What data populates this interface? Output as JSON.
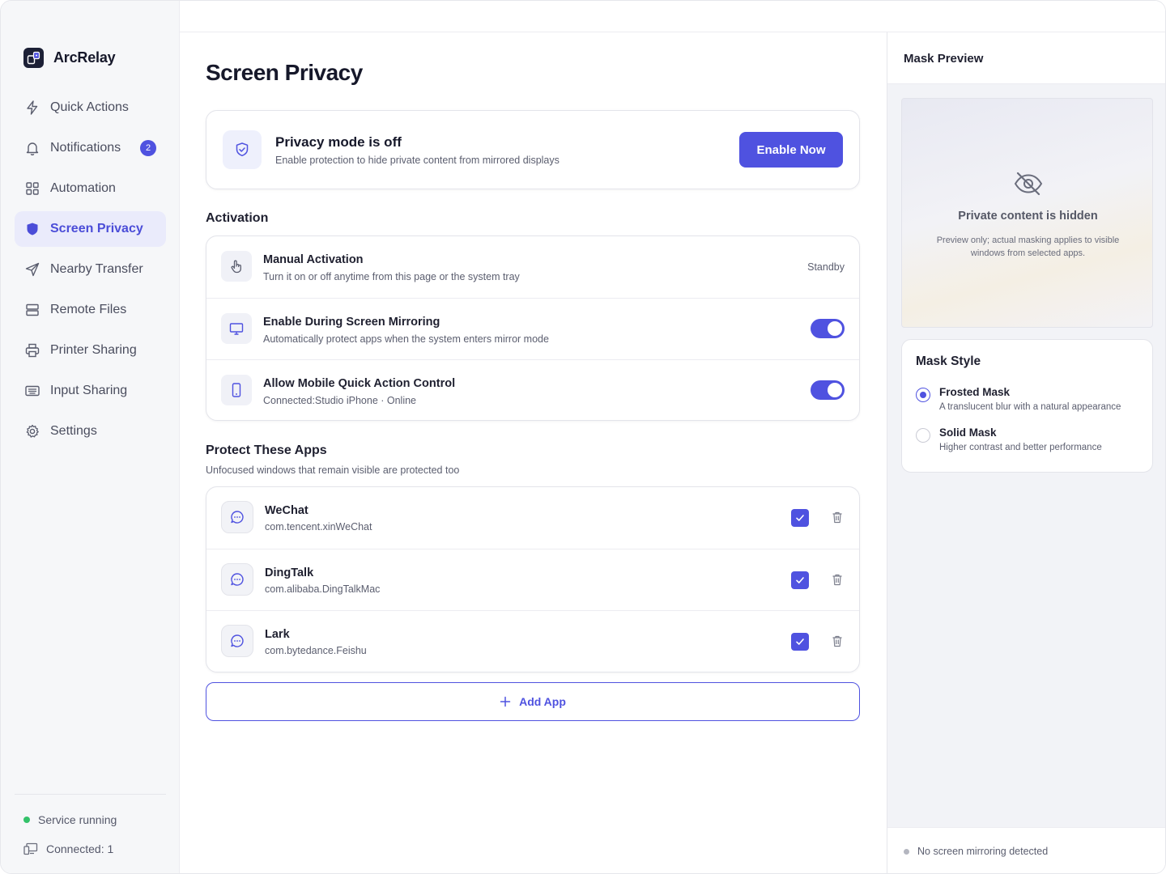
{
  "app": {
    "name": "ArcRelay"
  },
  "sidebar": {
    "items": [
      {
        "label": "Quick Actions",
        "icon": "lightning-icon"
      },
      {
        "label": "Notifications",
        "icon": "bell-icon",
        "badge": "2"
      },
      {
        "label": "Automation",
        "icon": "grid-icon"
      },
      {
        "label": "Screen Privacy",
        "icon": "shield-icon",
        "active": true
      },
      {
        "label": "Nearby Transfer",
        "icon": "send-icon"
      },
      {
        "label": "Remote Files",
        "icon": "server-icon"
      },
      {
        "label": "Printer Sharing",
        "icon": "printer-icon"
      },
      {
        "label": "Input Sharing",
        "icon": "keyboard-icon"
      },
      {
        "label": "Settings",
        "icon": "gear-icon"
      }
    ],
    "status": "Service running",
    "connected": "Connected: 1"
  },
  "main": {
    "title": "Screen Privacy",
    "privacy_card": {
      "title": "Privacy mode is off",
      "subtitle": "Enable protection to hide private content from mirrored displays",
      "button": "Enable Now"
    },
    "activation": {
      "heading": "Activation",
      "rows": [
        {
          "title": "Manual Activation",
          "subtitle": "Turn it on or off anytime from this page or the system tray",
          "status": "Standby"
        },
        {
          "title": "Enable During Screen Mirroring",
          "subtitle": "Automatically protect apps when the system enters mirror mode",
          "enabled": true
        },
        {
          "title": "Allow Mobile Quick Action Control",
          "subtitle": "Connected:Studio iPhone · Online",
          "enabled": true
        }
      ]
    },
    "apps": {
      "heading": "Protect These Apps",
      "subtitle": "Unfocused windows that remain visible are protected too",
      "list": [
        {
          "name": "WeChat",
          "bundle": "com.tencent.xinWeChat",
          "checked": true
        },
        {
          "name": "DingTalk",
          "bundle": "com.alibaba.DingTalkMac",
          "checked": true
        },
        {
          "name": "Lark",
          "bundle": "com.bytedance.Feishu",
          "checked": true
        }
      ],
      "add_label": "Add App"
    }
  },
  "panel": {
    "title": "Mask Preview",
    "preview_title": "Private content is hidden",
    "preview_sub": "Preview only; actual masking applies to visible windows from selected apps.",
    "mask_style": {
      "title": "Mask Style",
      "options": [
        {
          "label": "Frosted Mask",
          "description": "A translucent blur with a natural appearance",
          "selected": true
        },
        {
          "label": "Solid Mask",
          "description": "Higher contrast and better performance",
          "selected": false
        }
      ]
    },
    "footer": "No screen mirroring detected"
  },
  "colors": {
    "accent": "#4f52e0",
    "status_ok": "#34c26a",
    "status_idle": "#b4b6c0"
  }
}
